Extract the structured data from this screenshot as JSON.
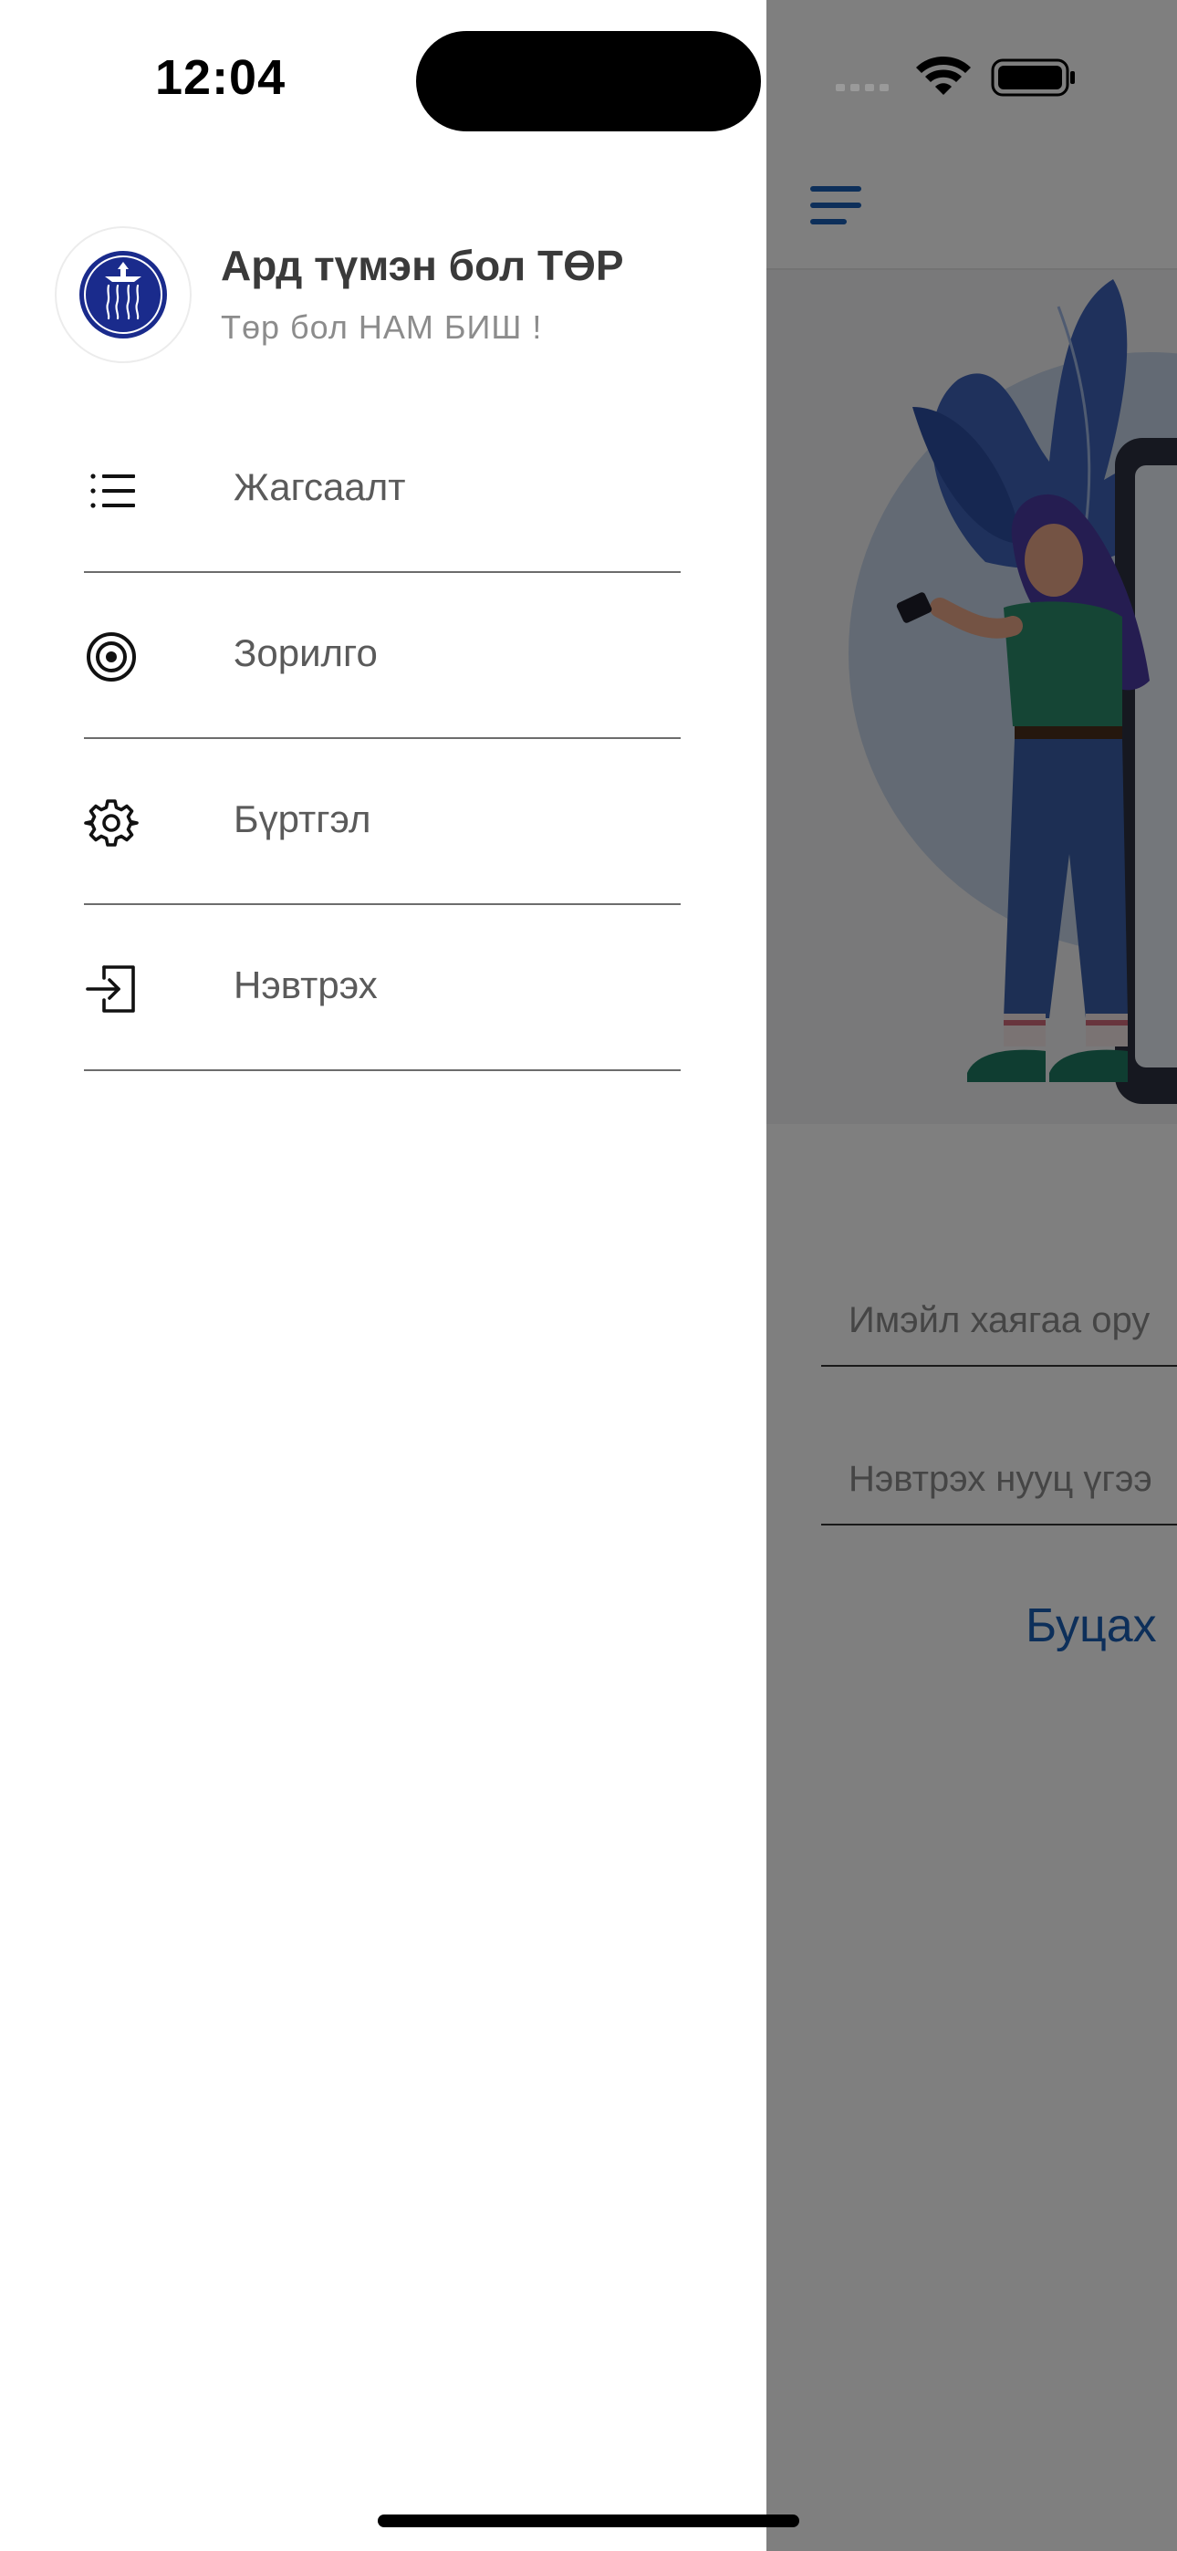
{
  "colors": {
    "accent": "#1a5fb4",
    "logo_blue": "#1a2b8c",
    "scrim": "rgba(0,0,0,0.5)"
  },
  "status_bar": {
    "time": "12:04",
    "icons": [
      "cellular-icon",
      "wifi-icon",
      "battery-icon"
    ]
  },
  "drawer": {
    "header": {
      "logo_icon": "party-logo-icon",
      "title": "Ард түмэн бол ТӨР",
      "subtitle": "Төр бол НАМ БИШ !"
    },
    "items": [
      {
        "label": "Жагсаалт",
        "icon": "list-icon"
      },
      {
        "label": "Зорилго",
        "icon": "target-icon"
      },
      {
        "label": "Бүртгэл",
        "icon": "gear-icon"
      },
      {
        "label": "Нэвтрэх",
        "icon": "login-icon"
      }
    ]
  },
  "background_app": {
    "menu_icon": "hamburger-menu-icon",
    "hero_image": "woman-with-phone-illustration",
    "email_placeholder": "Имэйл хаягаа ору",
    "password_placeholder": "Нэвтрэх нууц үгээ",
    "back_label": "Буцах"
  }
}
